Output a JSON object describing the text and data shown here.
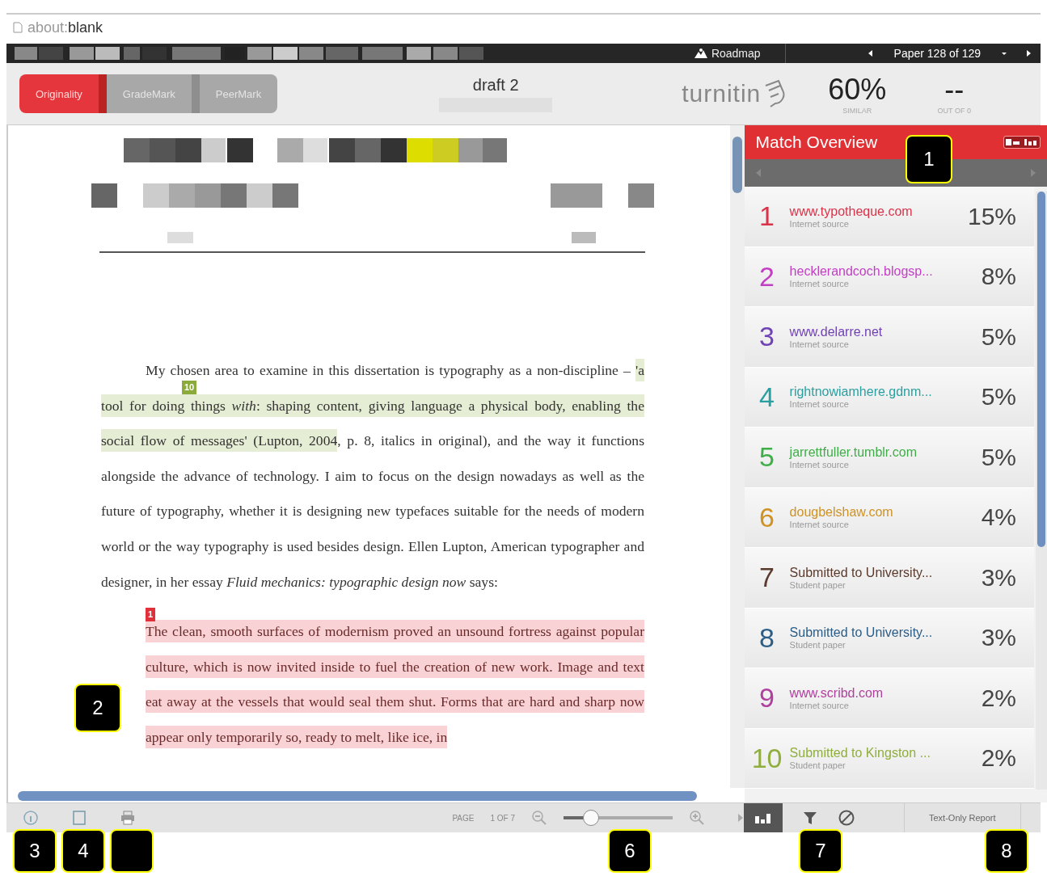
{
  "browser": {
    "address": "about:**blank**"
  },
  "topbar": {
    "roadmap": "Roadmap",
    "paper": "Paper 128 of 129"
  },
  "tabs": [
    {
      "label": "Originality",
      "selected": true
    },
    {
      "label": "GradeMark",
      "selected": false
    },
    {
      "label": "PeerMark",
      "selected": false
    }
  ],
  "title": "draft 2",
  "logo": "turnitin",
  "similarity": {
    "value": "60%",
    "label": "SIMILAR"
  },
  "grade": {
    "value": "--",
    "label": "OUT OF 0"
  },
  "document": {
    "paragraphs": [
      {
        "kind": "body",
        "segments": [
          {
            "text": "My chosen area to examine in this dissertation is typography as a non-discipline – "
          },
          {
            "text": "'a tool for doing things *with*: shaping content, giving language a physical body, enabling the social flow of messages' (Lupton, 2004",
            "match": "10",
            "color": "#8aab3c"
          },
          {
            "text": ", p. 8, italics in original), and the way it functions alongside the advance of technology. I aim to focus on the design nowadays as well as the future of typography, whether it is designing new typefaces suitable for the needs of modern world or the way typography is used besides design. Ellen Lupton, American typographer and designer, in her essay *Fluid mechanics: typographic design now* says:"
          }
        ]
      },
      {
        "kind": "quote",
        "segments": [
          {
            "text": "The clean, smooth surfaces of modernism proved an unsound fortress against popular culture, which is now invited inside to fuel the creation of new work. Image and text eat away at the vessels that would seal them shut. Forms that are hard and sharp now appear only temporarily so, ready to melt, like ice, in",
            "match": "1",
            "color": "#e0303c"
          }
        ]
      }
    ]
  },
  "match_overview": {
    "title": "Match Overview",
    "matches": [
      {
        "number": "1",
        "source": "www.typotheque.com",
        "type": "Internet source",
        "percent": "15%",
        "color": "#d9334a"
      },
      {
        "number": "2",
        "source": "hecklerandcoch.blogsp...",
        "type": "Internet source",
        "percent": "8%",
        "color": "#c23fc4"
      },
      {
        "number": "3",
        "source": "www.delarre.net",
        "type": "Internet source",
        "percent": "5%",
        "color": "#7043b5"
      },
      {
        "number": "4",
        "source": "rightnowiamhere.gdnm...",
        "type": "Internet source",
        "percent": "5%",
        "color": "#2a9fa0"
      },
      {
        "number": "5",
        "source": "jarrettfuller.tumblr.com",
        "type": "Internet source",
        "percent": "5%",
        "color": "#3fae48"
      },
      {
        "number": "6",
        "source": "dougbelshaw.com",
        "type": "Internet source",
        "percent": "4%",
        "color": "#cf9224"
      },
      {
        "number": "7",
        "source": "Submitted to University...",
        "type": "Student paper",
        "percent": "3%",
        "color": "#5a3a2c"
      },
      {
        "number": "8",
        "source": "Submitted to University...",
        "type": "Student paper",
        "percent": "3%",
        "color": "#2c5d86"
      },
      {
        "number": "9",
        "source": "www.scribd.com",
        "type": "Internet source",
        "percent": "2%",
        "color": "#b0409e"
      },
      {
        "number": "10",
        "source": "Submitted to Kingston ...",
        "type": "Student paper",
        "percent": "2%",
        "color": "#8fae3e"
      }
    ]
  },
  "toolbar": {
    "page_label": "PAGE",
    "page": "1 OF 7",
    "zoom": {
      "level": 0.25
    },
    "report": "Text-Only Report"
  },
  "callouts": [
    {
      "kind": "number",
      "label": "1"
    },
    {
      "kind": "number",
      "label": "2"
    },
    {
      "kind": "number",
      "label": "3"
    },
    {
      "kind": "number",
      "label": "4"
    },
    {
      "kind": "blank"
    },
    {
      "kind": "number",
      "label": "6"
    },
    {
      "kind": "number",
      "label": "7"
    },
    {
      "kind": "number",
      "label": "8"
    }
  ]
}
